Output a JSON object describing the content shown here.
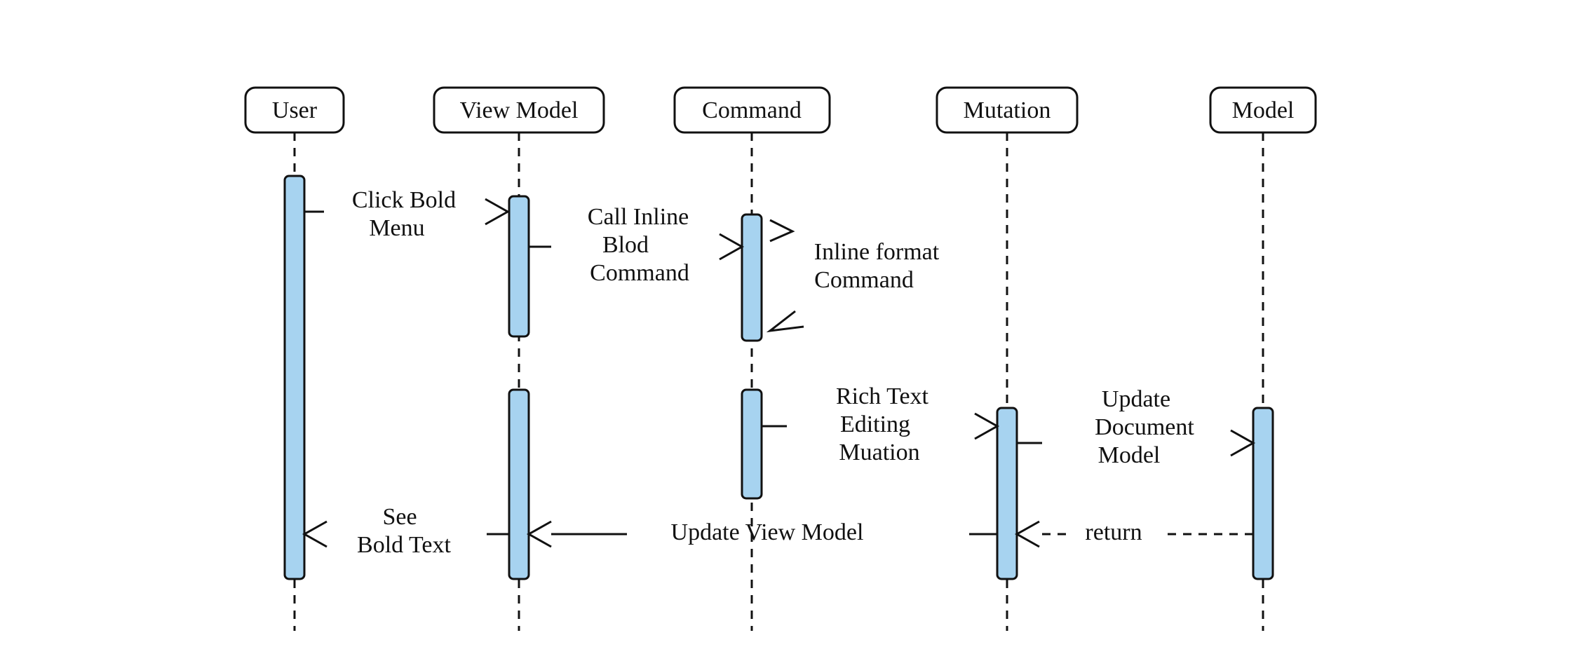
{
  "diagram": {
    "type": "sequence",
    "participants": [
      {
        "id": "user",
        "label": "User"
      },
      {
        "id": "vm",
        "label": "View Model"
      },
      {
        "id": "cmd",
        "label": "Command"
      },
      {
        "id": "mut",
        "label": "Mutation"
      },
      {
        "id": "model",
        "label": "Model"
      }
    ],
    "messages": {
      "m1": {
        "from": "user",
        "to": "vm",
        "label_l1": "Click Bold",
        "label_l2": "Menu"
      },
      "m2": {
        "from": "vm",
        "to": "cmd",
        "label_l1": "Call Inline",
        "label_l2": "Blod",
        "label_l3": "Command"
      },
      "m3": {
        "from": "cmd",
        "to": "cmd",
        "label_l1": "Inline format",
        "label_l2": "Command"
      },
      "m4": {
        "from": "cmd",
        "to": "mut",
        "label_l1": "Rich Text",
        "label_l2": "Editing",
        "label_l3": "Muation"
      },
      "m5": {
        "from": "mut",
        "to": "model",
        "label_l1": "Update",
        "label_l2": "Document",
        "label_l3": "Model"
      },
      "m6": {
        "from": "model",
        "to": "mut",
        "label_l1": "return",
        "style": "dashed"
      },
      "m7": {
        "from": "mut",
        "to": "vm",
        "label_l1": "Update View Model"
      },
      "m8": {
        "from": "vm",
        "to": "user",
        "label_l1": "See",
        "label_l2": "Bold Text"
      }
    }
  }
}
